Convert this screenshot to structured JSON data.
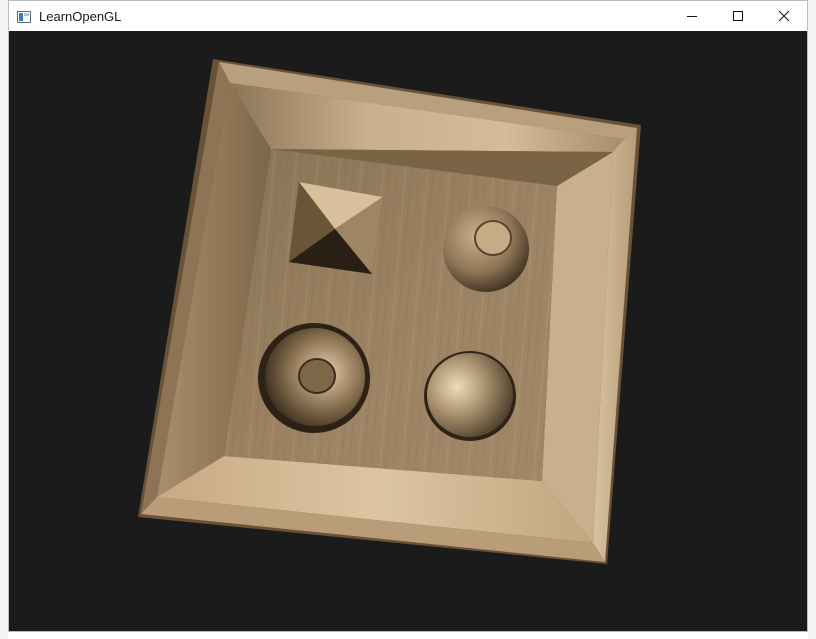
{
  "window": {
    "title": "LearnOpenGL",
    "background_color": "#1b1b1b",
    "icons": {
      "app": "window-app-icon",
      "minimize": "minimize-icon",
      "maximize": "maximize-icon",
      "close": "close-icon"
    }
  },
  "scene": {
    "description_icon": "parallax-mapped-toy-box",
    "surface_color": "#b49c7c",
    "shapes": [
      "pyramid",
      "sphere-cap-hole",
      "torus",
      "sphere"
    ]
  }
}
